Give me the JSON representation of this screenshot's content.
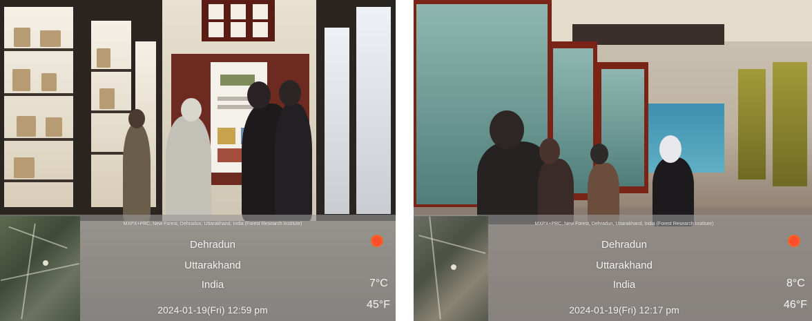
{
  "photos": [
    {
      "map_credit": "",
      "address": "MXPX+PRC, New Forest, Dehradun, Uttarakhand, India (Forest Research Institute)",
      "city": "Dehradun",
      "state": "Uttarakhand",
      "country": "India",
      "datetime": "2024-01-19(Fri)  12:59 pm",
      "temp_c": "7°C",
      "temp_f": "45°F",
      "weather_color": "#ff4d2e"
    },
    {
      "map_credit": "",
      "address": "MXPX+PRC, New Forest, Dehradun, Uttarakhand, India (Forest Research Institute)",
      "city": "Dehradun",
      "state": "Uttarakhand",
      "country": "India",
      "datetime": "2024-01-19(Fri)  12:17 pm",
      "temp_c": "8°C",
      "temp_f": "46°F",
      "weather_color": "#ff4d2e"
    }
  ]
}
